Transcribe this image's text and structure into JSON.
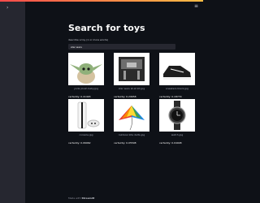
{
  "page": {
    "title": "Search for toys"
  },
  "search": {
    "label": "describe a toy (1 or more words)",
    "value": "star wars"
  },
  "results": [
    {
      "caption": "yoda plush baby.jpg",
      "certainty": "certainty: 0.41493"
    },
    {
      "caption": "star wars at-at kit.jpg",
      "certainty": "certainty: 0.29658"
    },
    {
      "caption": "sneakers black.jpg",
      "certainty": "certainty: 0.18779"
    },
    {
      "caption": "console.jpg",
      "certainty": "certainty: 0.06962"
    },
    {
      "caption": "rainbow kite delta.jpg",
      "certainty": "certainty: 0.05508"
    },
    {
      "caption": "watch.jpg",
      "certainty": "certainty: 0.04948"
    }
  ],
  "footer": {
    "prefix": "Made with",
    "brand": "Streamlit"
  },
  "icons": {
    "sidebar": "chevron-right-icon",
    "menu": "hamburger-menu-icon"
  },
  "colors": {
    "accent_start": "#ff4b4b",
    "accent_end": "#ffbd45",
    "background": "#0e1117"
  }
}
